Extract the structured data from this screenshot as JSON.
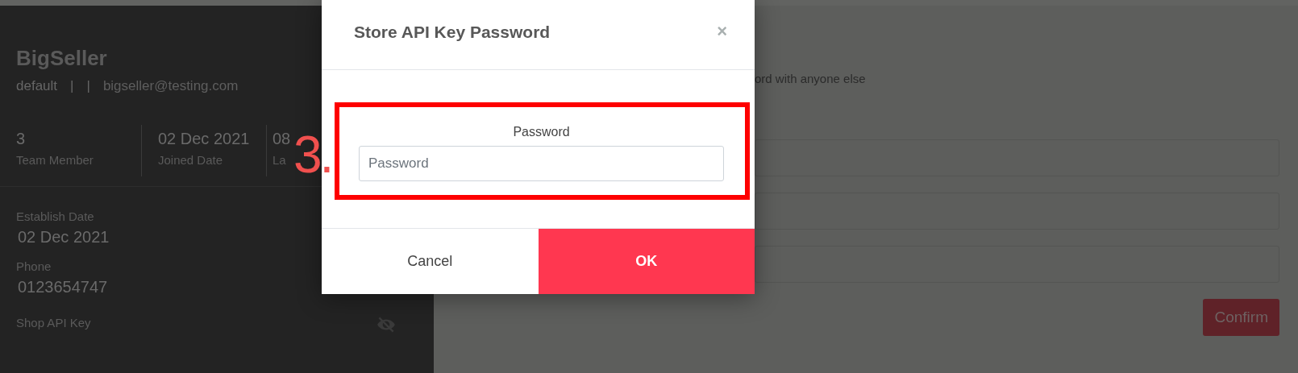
{
  "profile": {
    "name": {
      "text": "BigSeller",
      "blurred": false
    },
    "role": "default",
    "separators": [
      "|",
      "|"
    ],
    "email": {
      "text": "bigseller@testing.com",
      "blurred": false
    }
  },
  "stats": [
    {
      "value": "3",
      "label": "Team Member"
    },
    {
      "value": "02 Dec 2021",
      "label": "Joined Date"
    },
    {
      "value": "08",
      "label": "La"
    }
  ],
  "details": [
    {
      "label": "Establish Date",
      "value": "02 Dec 2021",
      "blurred": false
    },
    {
      "label": "Phone",
      "value": "0123654747",
      "blurred": false
    },
    {
      "label": "Shop API Key",
      "hidden": true
    }
  ],
  "form": {
    "notice": "ord with anyone else",
    "fields": [
      {
        "kind": "text"
      },
      {
        "kind": "text"
      },
      {
        "kind": "text"
      }
    ],
    "confirm_button": "Confirm"
  },
  "step_marker": "3.",
  "dialog": {
    "title": "Store API Key Password",
    "close": "×",
    "field_label": "Password",
    "placeholder": "Password",
    "highlighted": true,
    "buttons": [
      {
        "label": "Cancel",
        "kind": "secondary"
      },
      {
        "label": "OK",
        "kind": "primary"
      }
    ]
  }
}
